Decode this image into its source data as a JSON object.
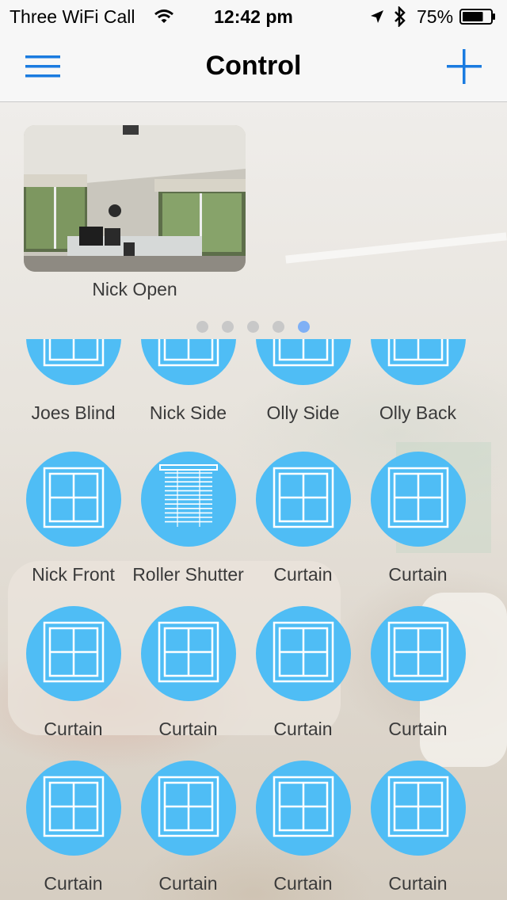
{
  "status_bar": {
    "carrier": "Three WiFi Call",
    "time": "12:42 pm",
    "battery_percent": "75%",
    "battery_level": 0.75
  },
  "nav": {
    "title": "Control",
    "left_icon": "menu-icon",
    "right_icon": "plus-icon"
  },
  "scene": {
    "label": "Nick Open"
  },
  "pager": {
    "count": 5,
    "active_index": 4
  },
  "colors": {
    "accent": "#1a7be0",
    "device_circle": "#4fbdf5",
    "dot_active": "#7fb0f5",
    "dot_inactive": "#c8c8c8"
  },
  "devices": [
    {
      "label": "Joes Blind",
      "icon": "window-icon"
    },
    {
      "label": "Nick Side",
      "icon": "window-icon"
    },
    {
      "label": "Olly Side",
      "icon": "window-icon"
    },
    {
      "label": "Olly Back",
      "icon": "window-icon"
    },
    {
      "label": "Nick Front",
      "icon": "window-icon"
    },
    {
      "label": "Roller Shutter",
      "icon": "roller-shutter-icon"
    },
    {
      "label": "Curtain",
      "icon": "window-icon"
    },
    {
      "label": "Curtain",
      "icon": "window-icon"
    },
    {
      "label": "Curtain",
      "icon": "window-icon"
    },
    {
      "label": "Curtain",
      "icon": "window-icon"
    },
    {
      "label": "Curtain",
      "icon": "window-icon"
    },
    {
      "label": "Curtain",
      "icon": "window-icon"
    },
    {
      "label": "Curtain",
      "icon": "window-icon"
    },
    {
      "label": "Curtain",
      "icon": "window-icon"
    },
    {
      "label": "Curtain",
      "icon": "window-icon"
    },
    {
      "label": "Curtain",
      "icon": "window-icon"
    }
  ]
}
